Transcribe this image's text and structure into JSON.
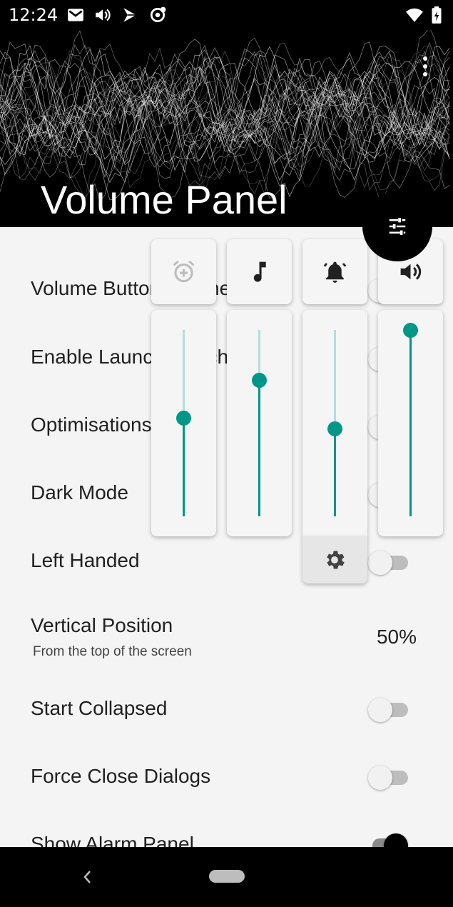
{
  "status_bar": {
    "time": "12:24",
    "left_icons": [
      "gmail-icon",
      "volume-icon",
      "play-store-icon",
      "location-target-icon"
    ],
    "right_icons": [
      "wifi-icon",
      "battery-icon"
    ]
  },
  "header": {
    "title": "Volume Panel",
    "menu_icon": "more-vert-icon"
  },
  "fab": {
    "icon": "tune-icon"
  },
  "settings": [
    {
      "key": "volume_button_listener",
      "label": "Volume Button Listener",
      "control": "switch",
      "on": false
    },
    {
      "key": "enable_launch_switch",
      "label": "Enable Launch Switch",
      "control": "switch",
      "on": false
    },
    {
      "key": "optimisations",
      "label": "Optimisations",
      "control": "switch",
      "on": false
    },
    {
      "key": "dark_mode",
      "label": "Dark Mode",
      "control": "switch",
      "on": false
    },
    {
      "key": "left_handed",
      "label": "Left Handed",
      "control": "switch",
      "on": false
    },
    {
      "key": "vertical_position",
      "label": "Vertical Position",
      "sublabel": "From the top of the screen",
      "value": "50%"
    },
    {
      "key": "start_collapsed",
      "label": "Start Collapsed",
      "control": "switch",
      "on": false
    },
    {
      "key": "force_close_dialogs",
      "label": "Force Close Dialogs",
      "control": "switch",
      "on": false
    },
    {
      "key": "show_alarm_panel",
      "label": "Show Alarm Panel",
      "control": "switch",
      "on": true
    }
  ],
  "volume_panel": {
    "streams": [
      {
        "name": "alarm",
        "icon": "alarm-add-icon",
        "level": 0.53
      },
      {
        "name": "music",
        "icon": "music-note-icon",
        "level": 0.73
      },
      {
        "name": "ring",
        "icon": "bell-icon",
        "level": 0.47
      },
      {
        "name": "media",
        "icon": "volume-up-icon",
        "level": 1.0
      }
    ],
    "settings_icon": "gear-icon"
  },
  "colors": {
    "accent": "#009688",
    "accent_light": "#b2dfdb",
    "background": "#f4f4f4"
  },
  "nav_bar": {
    "back_icon": "back-icon",
    "home_icon": "home-pill-icon"
  }
}
